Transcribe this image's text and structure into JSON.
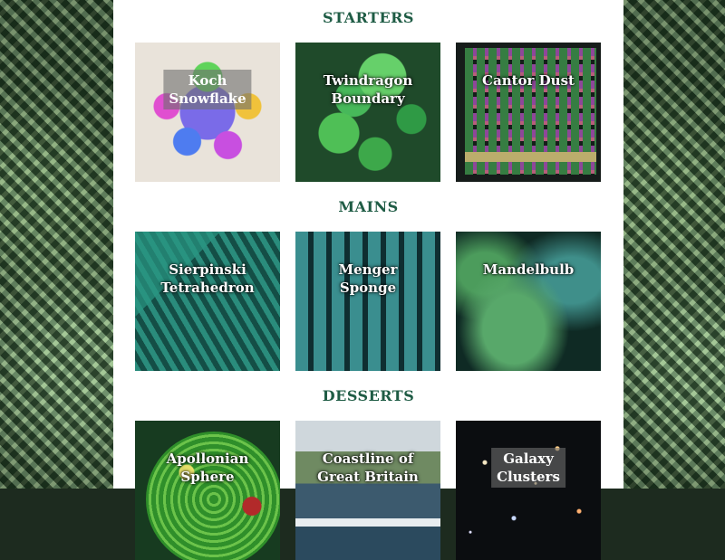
{
  "sections": [
    {
      "heading": "STARTERS",
      "tiles": [
        {
          "label_line1": "Koch",
          "label_line2": "Snowflake"
        },
        {
          "label_line1": "Twindragon",
          "label_line2": "Boundary"
        },
        {
          "label_line1": "Cantor Dust",
          "label_line2": ""
        }
      ]
    },
    {
      "heading": "MAINS",
      "tiles": [
        {
          "label_line1": "Sierpinski",
          "label_line2": "Tetrahedron"
        },
        {
          "label_line1": "Menger",
          "label_line2": "Sponge"
        },
        {
          "label_line1": "Mandelbulb",
          "label_line2": ""
        }
      ]
    },
    {
      "heading": "DESSERTS",
      "tiles": [
        {
          "label_line1": "Apollonian",
          "label_line2": "Sphere"
        },
        {
          "label_line1": "Coastline of",
          "label_line2": "Great Britain"
        },
        {
          "label_line1": "Galaxy",
          "label_line2": "Clusters"
        }
      ]
    }
  ],
  "colors": {
    "heading": "#1f5c45",
    "panel": "#ffffff"
  }
}
